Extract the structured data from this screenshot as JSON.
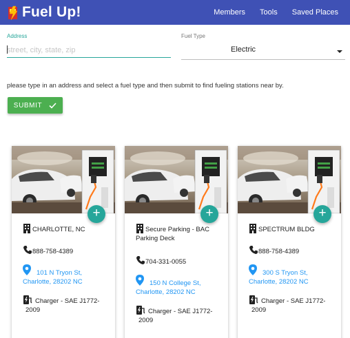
{
  "nav": {
    "brand": "Fuel Up!",
    "links": [
      "Members",
      "Tools",
      "Saved Places"
    ]
  },
  "form": {
    "address_label": "Address",
    "address_placeholder": "street, city, state, zip",
    "address_value": "",
    "fuel_label": "Fuel Type",
    "fuel_value": "Electric",
    "instructions": "please type in an address and select a fuel type and then submit to find fueling stations near by.",
    "submit_label": "SUBMIT"
  },
  "cards": [
    {
      "name": "CHARLOTTE, NC",
      "phone": "888-758-4389",
      "address_line1": "101 N Tryon St,",
      "address_line2": "Charlotte, 28202 NC",
      "charger": "Charger - SAE J1772-2009"
    },
    {
      "name": "Secure Parking - BAC Parking Deck",
      "phone": "704-331-0055",
      "address_line1": "150 N College St,",
      "address_line2": "Charlotte, 28202 NC",
      "charger": "Charger - SAE J1772-2009"
    },
    {
      "name": "SPECTRUM BLDG",
      "phone": "888-758-4389",
      "address_line1": "300 S Tryon St,",
      "address_line2": "Charlotte, 28202 NC",
      "charger": "Charger - SAE J1772-2009"
    }
  ],
  "colors": {
    "navbar": "#3f51b5",
    "accent": "#26a69a",
    "submit": "#4caf50",
    "link": "#2196f3"
  },
  "icons": {
    "card_name": "building-icon",
    "card_phone": "phone-icon",
    "card_address": "location-pin-icon",
    "card_charger": "ev-charger-icon",
    "fab": "add-icon",
    "submit": "check-icon"
  }
}
